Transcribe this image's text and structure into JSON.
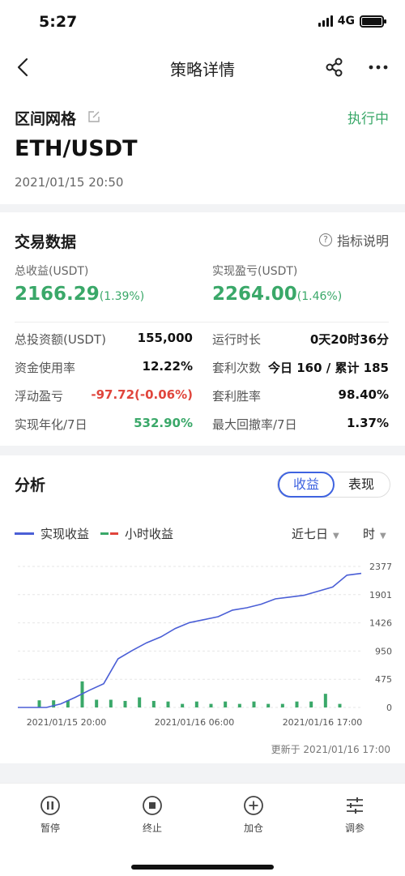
{
  "status_bar": {
    "time": "5:27",
    "network": "4G"
  },
  "nav": {
    "title": "策略详情",
    "icons": [
      "back-icon",
      "share-icon",
      "more-icon"
    ]
  },
  "strategy": {
    "type": "区间网格",
    "status": "执行中",
    "pair": "ETH/USDT",
    "created": "2021/01/15 20:50"
  },
  "trade": {
    "title": "交易数据",
    "help_label": "指标说明",
    "total_profit": {
      "label": "总收益(USDT)",
      "value": "2166.29",
      "pct": "(1.39%)"
    },
    "realized_pnl": {
      "label": "实现盈亏(USDT)",
      "value": "2264.00",
      "pct": "(1.46%)"
    },
    "rows": [
      {
        "l1": "总投资额(USDT)",
        "v1": "155,000",
        "l2": "运行时长",
        "v2": "0天20时36分"
      },
      {
        "l1": "资金使用率",
        "v1": "12.22%",
        "l2": "套利次数",
        "v2": "今日 160 / 累计 185"
      },
      {
        "l1": "浮动盈亏",
        "v1": "-97.72(-0.06%)",
        "l2": "套利胜率",
        "v2": "98.40%"
      },
      {
        "l1": "实现年化/7日",
        "v1": "532.90%",
        "l2": "最大回撤率/7日",
        "v2": "1.37%"
      }
    ]
  },
  "analysis": {
    "title": "分析",
    "tabs": [
      "收益",
      "表现"
    ],
    "legend_line": "实现收益",
    "legend_bar": "小时收益",
    "range_select": "近七日",
    "unit_select": "时",
    "updated": "更新于 2021/01/16 17:00"
  },
  "chart_data": {
    "type": "line",
    "x_tick_labels": [
      "2021/01/15 20:00",
      "2021/01/16 06:00",
      "2021/01/16 17:00"
    ],
    "y_tick_labels": [
      "2377",
      "1901",
      "1426",
      "950",
      "475",
      "0"
    ],
    "ylim": [
      0,
      2377
    ],
    "series": [
      {
        "name": "实现收益",
        "type": "line",
        "color": "#4b5fd6",
        "values": [
          0,
          0,
          0,
          60,
          170,
          290,
          400,
          820,
          960,
          1090,
          1190,
          1330,
          1430,
          1480,
          1530,
          1640,
          1680,
          1740,
          1830,
          1860,
          1890,
          1960,
          2030,
          2230,
          2260
        ]
      },
      {
        "name": "小时收益",
        "type": "bar",
        "color": "#3aa869",
        "values": [
          0,
          120,
          120,
          120,
          440,
          130,
          130,
          110,
          170,
          110,
          100,
          60,
          100,
          60,
          100,
          60,
          100,
          60,
          60,
          100,
          100,
          230,
          60,
          0
        ]
      }
    ],
    "grid": true
  },
  "toolbar": {
    "items": [
      {
        "label": "暂停",
        "icon": "pause-icon"
      },
      {
        "label": "终止",
        "icon": "stop-icon"
      },
      {
        "label": "加仓",
        "icon": "add-icon"
      },
      {
        "label": "调参",
        "icon": "sliders-icon"
      }
    ]
  }
}
